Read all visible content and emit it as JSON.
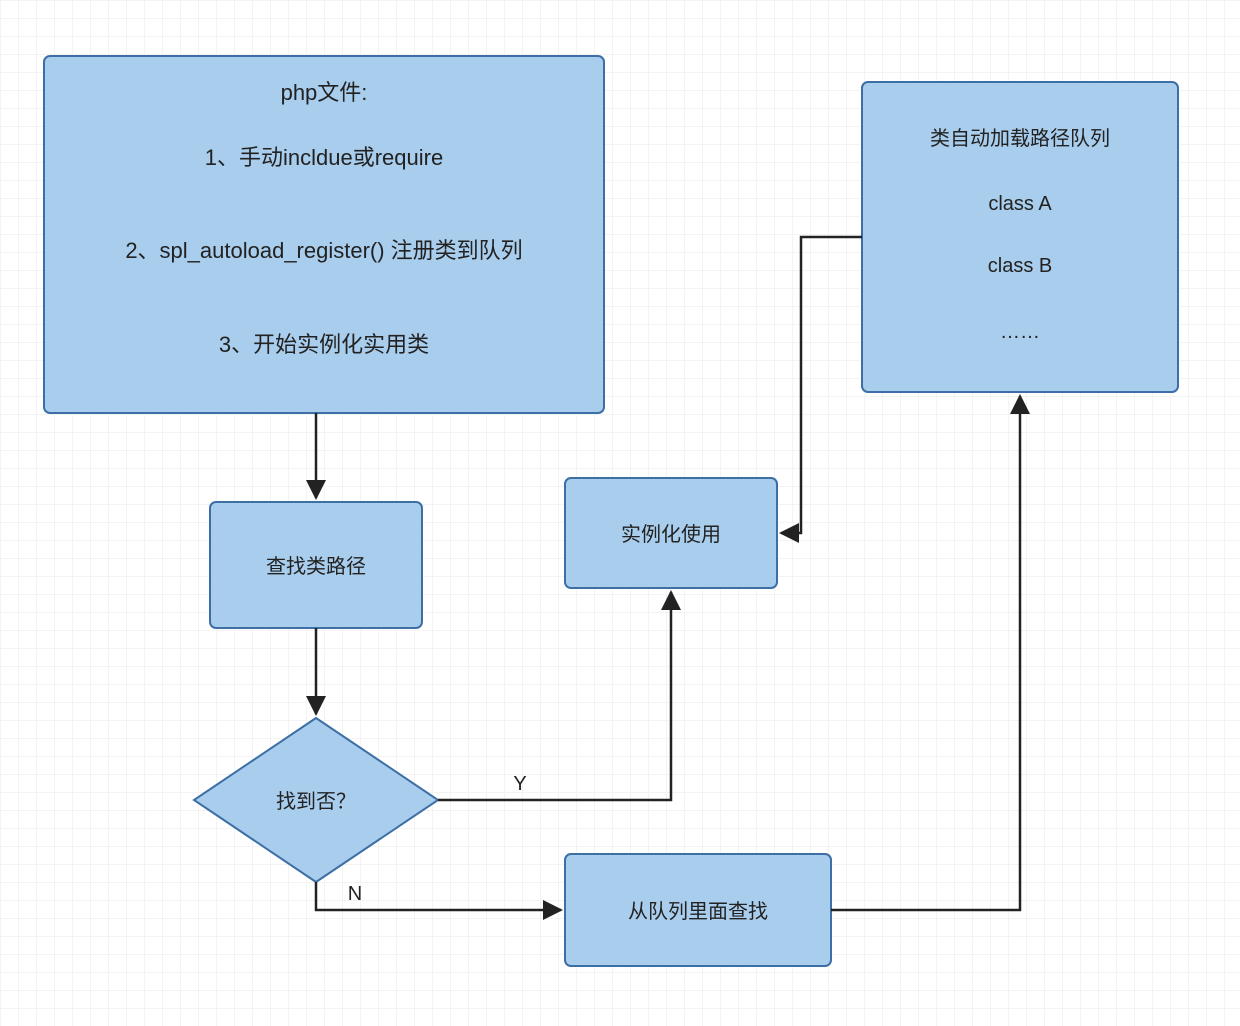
{
  "colors": {
    "node_fill": "#A9CDEC",
    "node_stroke": "#3D6FA6",
    "arrow_stroke": "#222222"
  },
  "nodes": {
    "php_file": {
      "title": "php文件:",
      "line1": "1、手动incldue或require",
      "line2": "2、spl_autoload_register() 注册类到队列",
      "line3": "3、开始实例化实用类"
    },
    "find_path": "查找类路径",
    "found_q": "找到否？",
    "queue_search": "从队列里面查找",
    "instantiate": "实例化使用",
    "queue_list": {
      "title": "类自动加载路径队列",
      "item1": "class A",
      "item2": "class B",
      "item3": "……"
    }
  },
  "edges": {
    "yes": "Y",
    "no": "N"
  }
}
